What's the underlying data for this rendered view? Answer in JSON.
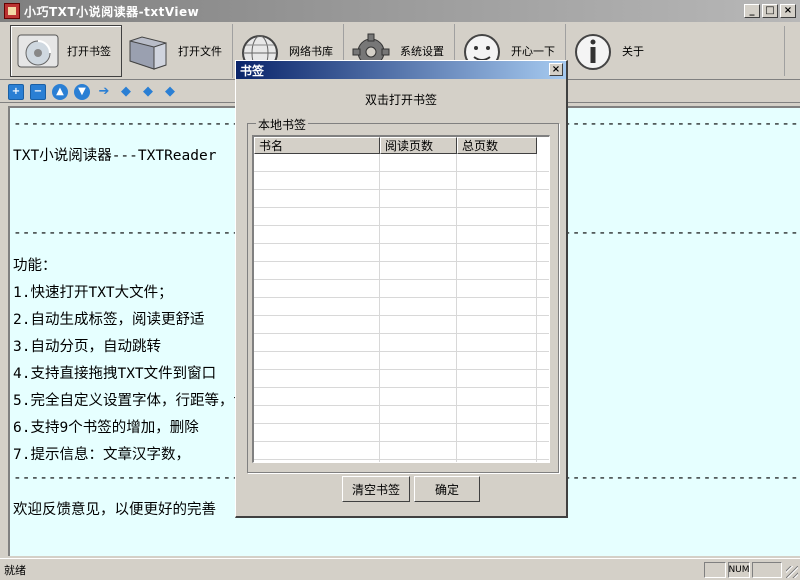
{
  "window": {
    "title": "小巧TXT小说阅读器-txtView",
    "controls": [
      "_",
      "□",
      "×"
    ]
  },
  "toolbar": {
    "items": [
      {
        "label": "打开书签",
        "icon": "disc-drive-icon"
      },
      {
        "label": "打开文件",
        "icon": "folder-icon"
      },
      {
        "label": "网络书库",
        "icon": "globe-icon"
      },
      {
        "label": "系统设置",
        "icon": "gear-icon"
      },
      {
        "label": "开心一下",
        "icon": "smiley-icon"
      },
      {
        "label": "关于",
        "icon": "info-icon"
      }
    ]
  },
  "small_toolbar": {
    "icons": [
      "add-icon",
      "minus-icon",
      "up-circle-icon",
      "down-circle-icon",
      "arrow-right-icon",
      "arrow-left-icon",
      "arrow-down-icon",
      "arrow-up-icon"
    ]
  },
  "content": {
    "lines": [
      "-----------------------------------------------------------------------------------------------------",
      "TXT小说阅读器---TXTReader",
      "-----------------------------------------------------------------------------------------------------",
      "功能：",
      "1.快速打开TXT大文件；",
      "2.自动生成标签，阅读更舒适",
      "3.自动分页，自动跳转",
      "4.支持直接拖拽TXT文件到窗口",
      "5.完全自定义设置字体，行距等，记住方案和上次的进度；",
      "6.支持9个书签的增加，删除",
      "7.提示信息：文章汉字数，",
      "-----------------------------------------------------------------------------------------------------",
      "欢迎反馈意见，以便更好的完善"
    ]
  },
  "dialog": {
    "title": "书签",
    "close": "×",
    "hint": "双击打开书签",
    "group_label": "本地书签",
    "columns": [
      "书名",
      "阅读页数",
      "总页数"
    ],
    "rows": [],
    "buttons": {
      "clear": "清空书签",
      "ok": "确定"
    }
  },
  "statusbar": {
    "text": "就绪",
    "num": "NUM"
  },
  "colors": {
    "content_bg": "#e6ffff",
    "dialog_title_start": "#0a246a",
    "dialog_title_end": "#a6caf0"
  }
}
